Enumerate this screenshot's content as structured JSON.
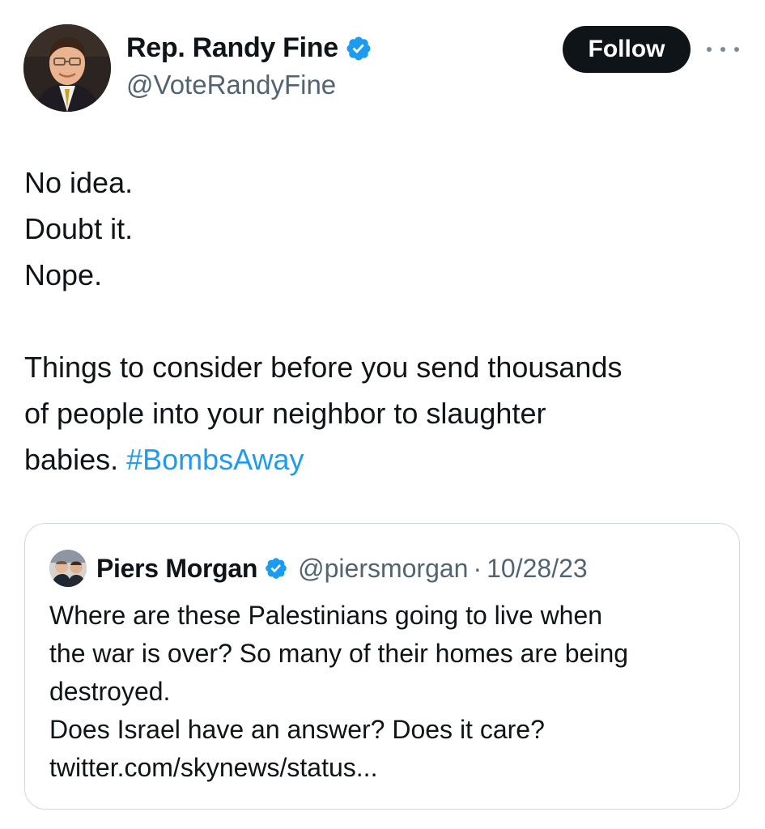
{
  "author": {
    "display_name": "Rep. Randy Fine",
    "handle": "@VoteRandyFine",
    "verified": true,
    "avatar_icon": "profile-photo"
  },
  "actions": {
    "follow_label": "Follow",
    "more_icon": "ellipsis-icon"
  },
  "tweet": {
    "lines": [
      "No idea.",
      "Doubt it.",
      "Nope."
    ],
    "paragraph": [
      "Things to consider before you send thousands",
      "of people into your neighbor to slaughter",
      "babies."
    ],
    "hashtag": "#BombsAway"
  },
  "quote": {
    "display_name": "Piers Morgan",
    "handle": "@piersmorgan",
    "separator": "·",
    "date": "10/28/23",
    "verified": true,
    "lines": [
      "Where are these Palestinians going to live when",
      "the war is over? So many of their homes are being",
      "destroyed.",
      "Does Israel have an answer? Does it care?",
      "twitter.com/skynews/status..."
    ]
  },
  "colors": {
    "accent": "#1d9bf0",
    "text": "#0f1419",
    "secondary": "#536471",
    "border": "#cfd9de",
    "follow_bg": "#0f1419"
  }
}
